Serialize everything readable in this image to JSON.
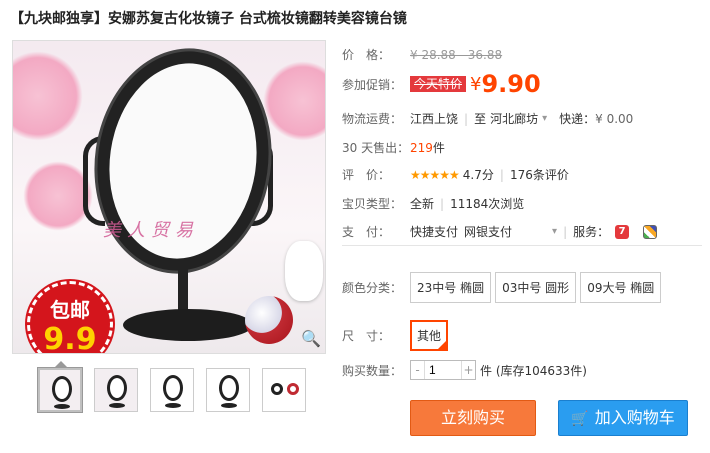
{
  "title": "【九块邮独享】安娜苏复古化妆镜子 台式梳妆镜翻转美容镜台镜",
  "image": {
    "watermark": "美人贸易",
    "badge_top": "包邮",
    "badge_price": "9.9"
  },
  "info": {
    "price_label": "价　格：",
    "price_range": "¥ 28.88 - 36.88",
    "promo_label": "参加促销：",
    "promo_tag": "今天特价",
    "promo_currency": "¥",
    "promo_price": "9.90",
    "shipping_label": "物流运费：",
    "ship_from": "江西上饶",
    "ship_to_prefix": "至",
    "ship_to": "河北廊坊",
    "express_label": "快递：",
    "express_fee": "¥ 0.00",
    "sold_label": "30 天售出：",
    "sold_count": "219",
    "sold_unit": "件",
    "rating_label": "评　价：",
    "rating_stars": "★★★★★",
    "rating_score": "4.7分",
    "review_count": "176条评价",
    "type_label": "宝贝类型：",
    "type_value": "全新",
    "views": "11184次浏览",
    "pay_label": "支　付：",
    "pay_quick": "快捷支付",
    "pay_bank": "网银支付",
    "service_label": "服务：",
    "service_icon_text": "7"
  },
  "options": {
    "color_label": "颜色分类：",
    "colors": [
      "23中号 椭圆",
      "03中号 圆形",
      "09大号 椭圆"
    ],
    "size_label": "尺　寸：",
    "sizes": [
      "其他"
    ]
  },
  "purchase": {
    "qty_label": "购买数量：",
    "qty_value": "1",
    "stock_text": "件 (库存104633件)",
    "buy_label": "立刻购买",
    "cart_label": "加入购物车"
  },
  "colors": {
    "accent": "#ff4400",
    "buy_button": "#f7793b",
    "cart_button": "#2a9df0",
    "badge": "#d4151c"
  },
  "icons": [
    "zoom-icon",
    "chevron-down-icon",
    "cart-icon",
    "dropdown-icon"
  ]
}
